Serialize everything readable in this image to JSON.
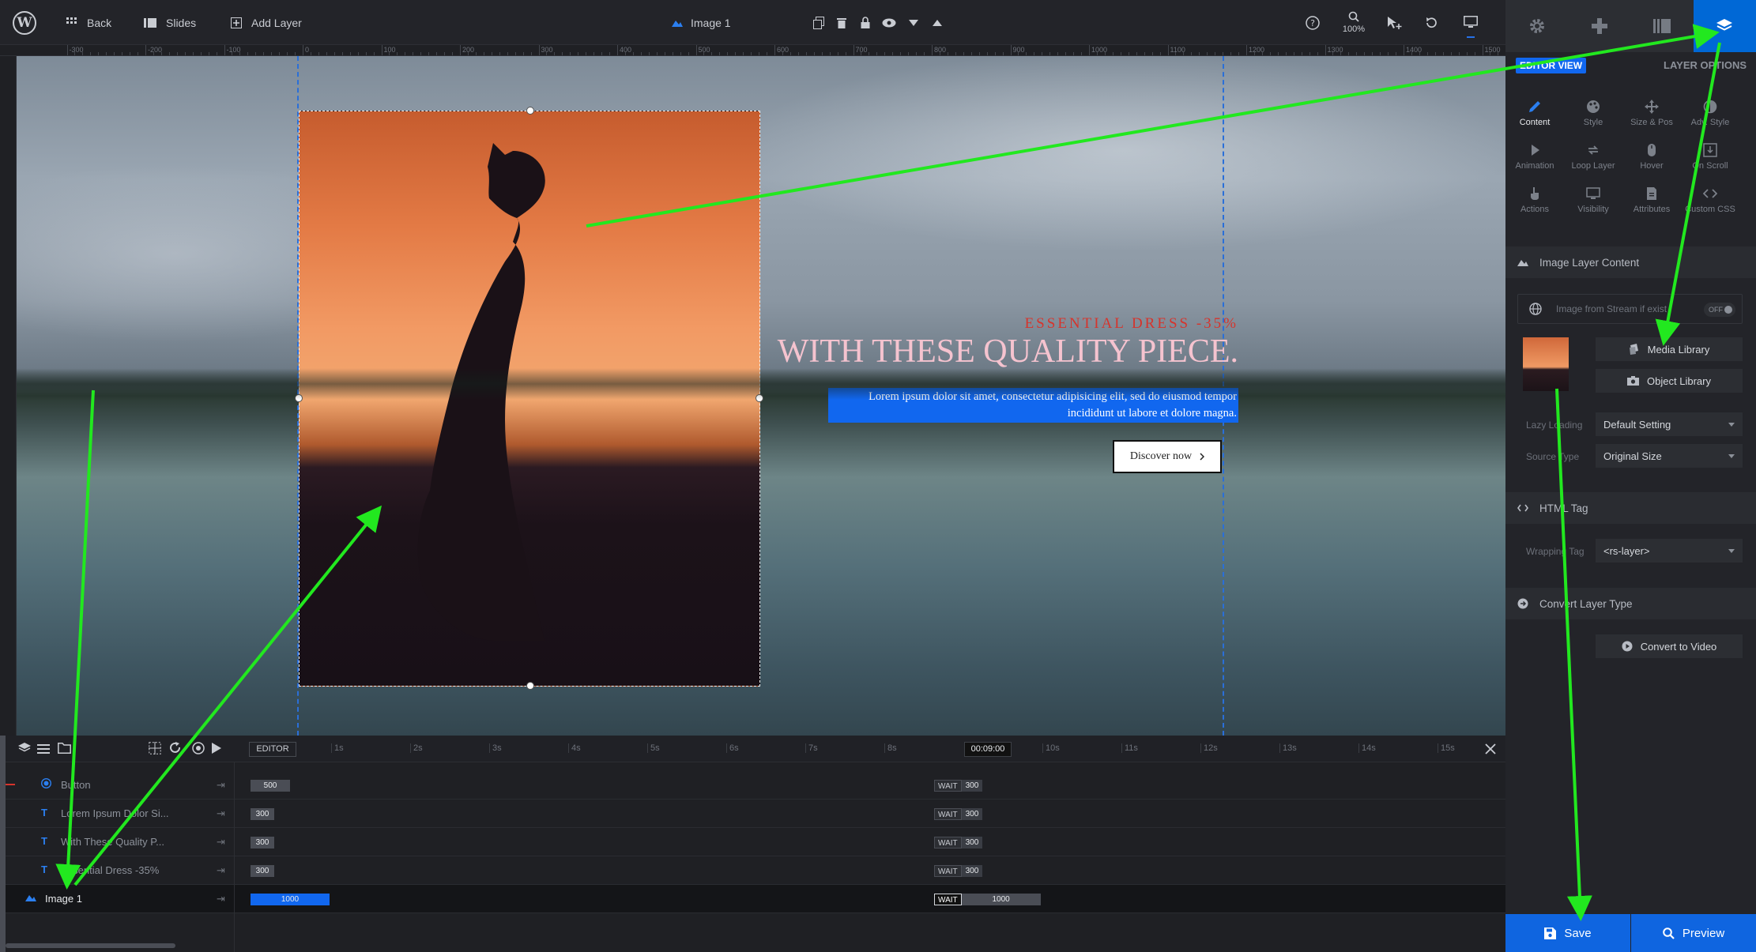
{
  "topbar": {
    "back_label": "Back",
    "slides_label": "Slides",
    "add_layer_label": "Add Layer",
    "current_layer_label": "Image 1",
    "zoom_label": "100%"
  },
  "ruler": {
    "labels": [
      "-300",
      "-200",
      "-100",
      "0",
      "100",
      "200",
      "300",
      "400",
      "500",
      "600",
      "700",
      "800",
      "900",
      "1000",
      "1100",
      "1200",
      "1300",
      "1400",
      "1500"
    ]
  },
  "canvas": {
    "essential_text": "ESSENTIAL DRESS -35%",
    "quality_text": "WITH THESE QUALITY PIECE.",
    "lorem_text": "Lorem ipsum dolor sit amet, consectetur adipisicing elit, sed do eiusmod tempor incididunt ut labore et dolore magna.",
    "button_label": "Discover now"
  },
  "panel": {
    "editor_view_label": "EDITOR VIEW",
    "layer_options_label": "LAYER OPTIONS",
    "icons": [
      "Content",
      "Style",
      "Size & Pos",
      "Adv. Style",
      "Animation",
      "Loop Layer",
      "Hover",
      "On Scroll",
      "Actions",
      "Visibility",
      "Attributes",
      "Custom CSS"
    ],
    "active_icon": "Content",
    "image_section_title": "Image Layer Content",
    "stream_label": "Image from Stream if exist",
    "stream_toggle": "OFF",
    "media_library_label": "Media Library",
    "object_library_label": "Object Library",
    "lazy_loading_label": "Lazy Loading",
    "lazy_loading_value": "Default Setting",
    "source_type_label": "Source Type",
    "source_type_value": "Original Size",
    "html_tag_title": "HTML Tag",
    "wrapping_tag_label": "Wrapping Tag",
    "wrapping_tag_value": "<rs-layer>",
    "convert_title": "Convert Layer Type",
    "convert_video_label": "Convert to Video",
    "save_label": "Save",
    "preview_label": "Preview"
  },
  "timeline": {
    "editor_label": "EDITOR",
    "seconds": [
      "1s",
      "2s",
      "3s",
      "4s",
      "5s",
      "6s",
      "7s",
      "8s",
      "9s",
      "10s",
      "11s",
      "12s",
      "13s",
      "14s",
      "15s"
    ],
    "current_time": "00:09:00",
    "rows": [
      {
        "name": "Button",
        "icon": "button",
        "duration": "500",
        "wait": "WAIT",
        "wait_value": "300"
      },
      {
        "name": "Lorem Ipsum Dolor Si...",
        "icon": "T",
        "duration": "300",
        "wait": "WAIT",
        "wait_value": "300"
      },
      {
        "name": "With These Quality P...",
        "icon": "T",
        "duration": "300",
        "wait": "WAIT",
        "wait_value": "300"
      },
      {
        "name": "Essential Dress -35%",
        "icon": "T",
        "duration": "300",
        "wait": "WAIT",
        "wait_value": "300"
      },
      {
        "name": "Image 1",
        "icon": "image",
        "duration": "1000",
        "wait": "WAIT",
        "wait_value": "1000"
      }
    ]
  },
  "colors": {
    "accent": "#1167ef",
    "annotation_arrow": "#22e81f",
    "sale_text": "#d6342c",
    "headline_text": "#f5c3cf"
  }
}
